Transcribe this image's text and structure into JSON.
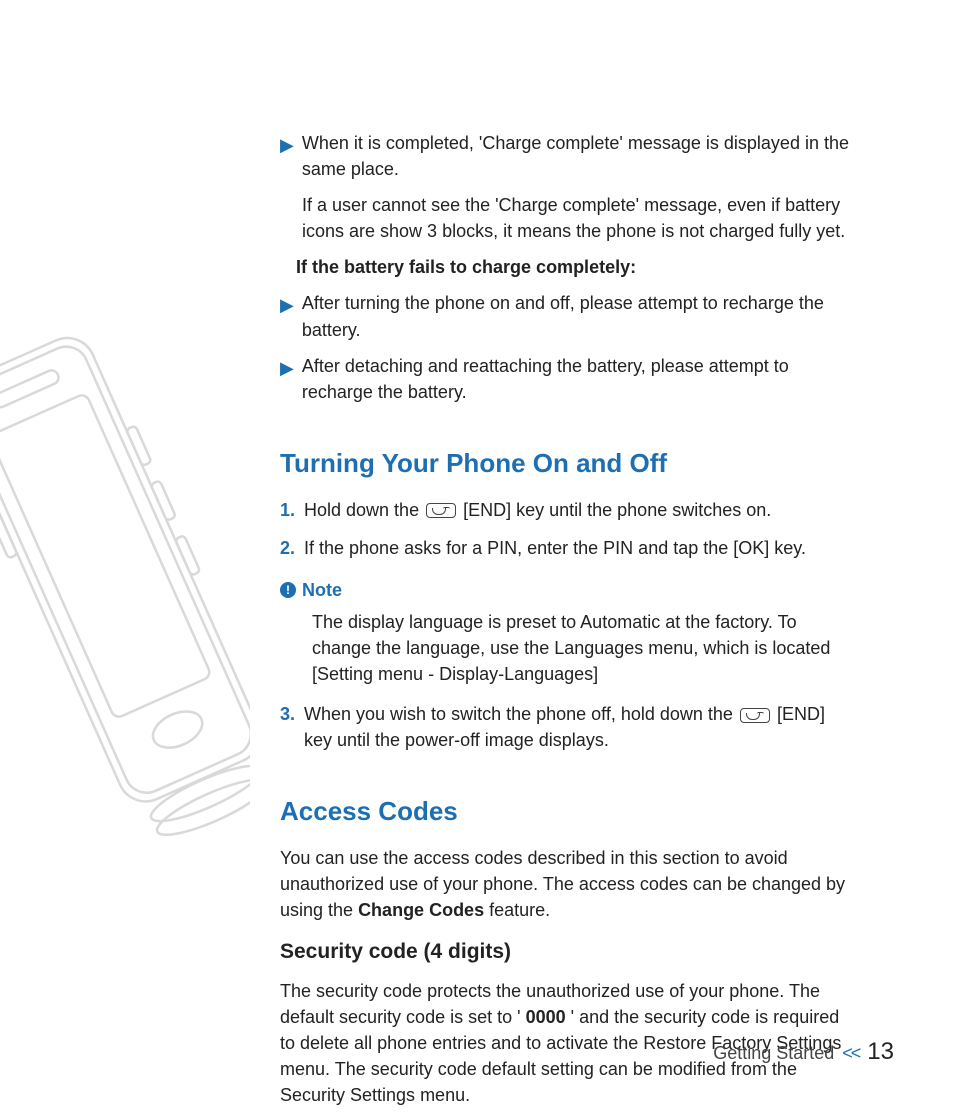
{
  "intro": {
    "bullet1": "When it is completed, 'Charge complete' message is displayed in the same place.",
    "bullet1_sub": "If a user cannot see the 'Charge complete' message, even if battery icons are show 3 blocks, it means the phone is not charged fully yet.",
    "fail_line": "If the battery fails to charge completely:",
    "bullet2": "After turning the phone on and off, please attempt to recharge the battery.",
    "bullet3": "After detaching and reattaching the battery, please attempt to recharge the battery."
  },
  "turning": {
    "heading": "Turning Your Phone On and Off",
    "steps": [
      {
        "num": "1.",
        "pre": "Hold down the ",
        "post": " [END] key until the phone switches on."
      },
      {
        "num": "2.",
        "text": "If the phone asks for a PIN, enter the PIN and tap the [OK] key."
      },
      {
        "num": "3.",
        "pre": "When you wish to switch the phone off, hold down the ",
        "post": " [END] key until the power-off image displays."
      }
    ],
    "note_label": "Note",
    "note_body": "The display language is preset to Automatic at the factory. To change the language, use the Languages menu, which is located [Setting menu - Display-Languages]"
  },
  "access": {
    "heading": "Access Codes",
    "intro_a": "You can use the access codes described in this section to avoid unauthorized use of your phone. The access codes can be changed by using the ",
    "intro_bold": "Change Codes",
    "intro_b": " feature.",
    "sub_heading": "Security code (4 digits)",
    "sec_a": "The security code protects the unauthorized use of your phone. The default security code is set to '",
    "sec_bold": "0000",
    "sec_b": "' and the security code is required to delete all phone entries and to activate the Restore Factory Settings menu. The security code default setting can be modified from the Security Settings menu."
  },
  "footer": {
    "section": "Getting Started",
    "chev": "<<",
    "page": "13"
  }
}
